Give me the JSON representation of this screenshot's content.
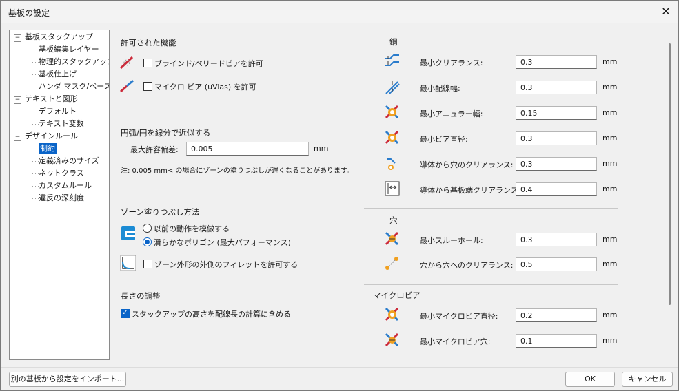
{
  "window": {
    "title": "基板の設定",
    "close_icon": "close-icon"
  },
  "tree": [
    {
      "label": "基板スタックアップ",
      "level": 0,
      "toggle": "⊟"
    },
    {
      "label": "基板編集レイヤー",
      "level": 1
    },
    {
      "label": "物理的スタックアップ",
      "level": 1
    },
    {
      "label": "基板仕上げ",
      "level": 1
    },
    {
      "label": "ハンダ マスク/ペースト",
      "level": 1
    },
    {
      "label": "テキストと図形",
      "level": 0,
      "toggle": "⊟"
    },
    {
      "label": "デフォルト",
      "level": 1
    },
    {
      "label": "テキスト変数",
      "level": 1
    },
    {
      "label": "デザインルール",
      "level": 0,
      "toggle": "⊟"
    },
    {
      "label": "制約",
      "level": 1,
      "selected": true
    },
    {
      "label": "定義済みのサイズ",
      "level": 1
    },
    {
      "label": "ネットクラス",
      "level": 1
    },
    {
      "label": "カスタムルール",
      "level": 1
    },
    {
      "label": "違反の深刻度",
      "level": 1
    }
  ],
  "features": {
    "heading": "許可された機能",
    "blind_vias": "ブラインド/ベリードビアを許可",
    "micro_vias": "マイクロ ビア (uVias) を許可"
  },
  "arc": {
    "heading": "円弧/円を線分で近似する",
    "max_error_label": "最大許容偏差:",
    "max_error_value": "0.005",
    "unit": "mm",
    "note": "注: 0.005 mm< の場合にゾーンの塗りつぶしが遅くなることがあります。"
  },
  "zone": {
    "heading": "ゾーン塗りつぶし方法",
    "option_legacy": "以前の動作を模倣する",
    "option_smooth": "滑らかなポリゴン (最大パフォーマンス)",
    "fillets": "ゾーン外形の外側のフィレットを許可する"
  },
  "length": {
    "heading": "長さの調整",
    "include_stackup": "スタックアップの高さを配線長の計算に含める"
  },
  "copper": {
    "heading": "銅",
    "rows": [
      {
        "label": "最小クリアランス:",
        "value": "0.3",
        "unit": "mm",
        "icon": "clearance-icon"
      },
      {
        "label": "最小配線幅:",
        "value": "0.3",
        "unit": "mm",
        "icon": "track-width-icon"
      },
      {
        "label": "最小アニュラー幅:",
        "value": "0.15",
        "unit": "mm",
        "icon": "annular-width-icon"
      },
      {
        "label": "最小ビア直径:",
        "value": "0.3",
        "unit": "mm",
        "icon": "via-diameter-icon"
      },
      {
        "label": "導体から穴のクリアランス:",
        "value": "0.3",
        "unit": "mm",
        "icon": "copper-hole-clearance-icon"
      },
      {
        "label": "導体から基板端クリアランス:",
        "value": "0.4",
        "unit": "mm",
        "icon": "edge-clearance-icon"
      }
    ]
  },
  "holes": {
    "heading": "穴",
    "rows": [
      {
        "label": "最小スルーホール:",
        "value": "0.3",
        "unit": "mm",
        "icon": "through-hole-icon"
      },
      {
        "label": "穴から穴へのクリアランス:",
        "value": "0.5",
        "unit": "mm",
        "icon": "hole-to-hole-icon"
      }
    ]
  },
  "microvias": {
    "heading": "マイクロビア",
    "rows": [
      {
        "label": "最小マイクロビア直径:",
        "value": "0.2",
        "unit": "mm",
        "icon": "microvia-diameter-icon"
      },
      {
        "label": "最小マイクロビア穴:",
        "value": "0.1",
        "unit": "mm",
        "icon": "microvia-hole-icon"
      }
    ]
  },
  "footer": {
    "import": "別の基板から設定をインポート...",
    "ok": "OK",
    "cancel": "キャンセル"
  }
}
